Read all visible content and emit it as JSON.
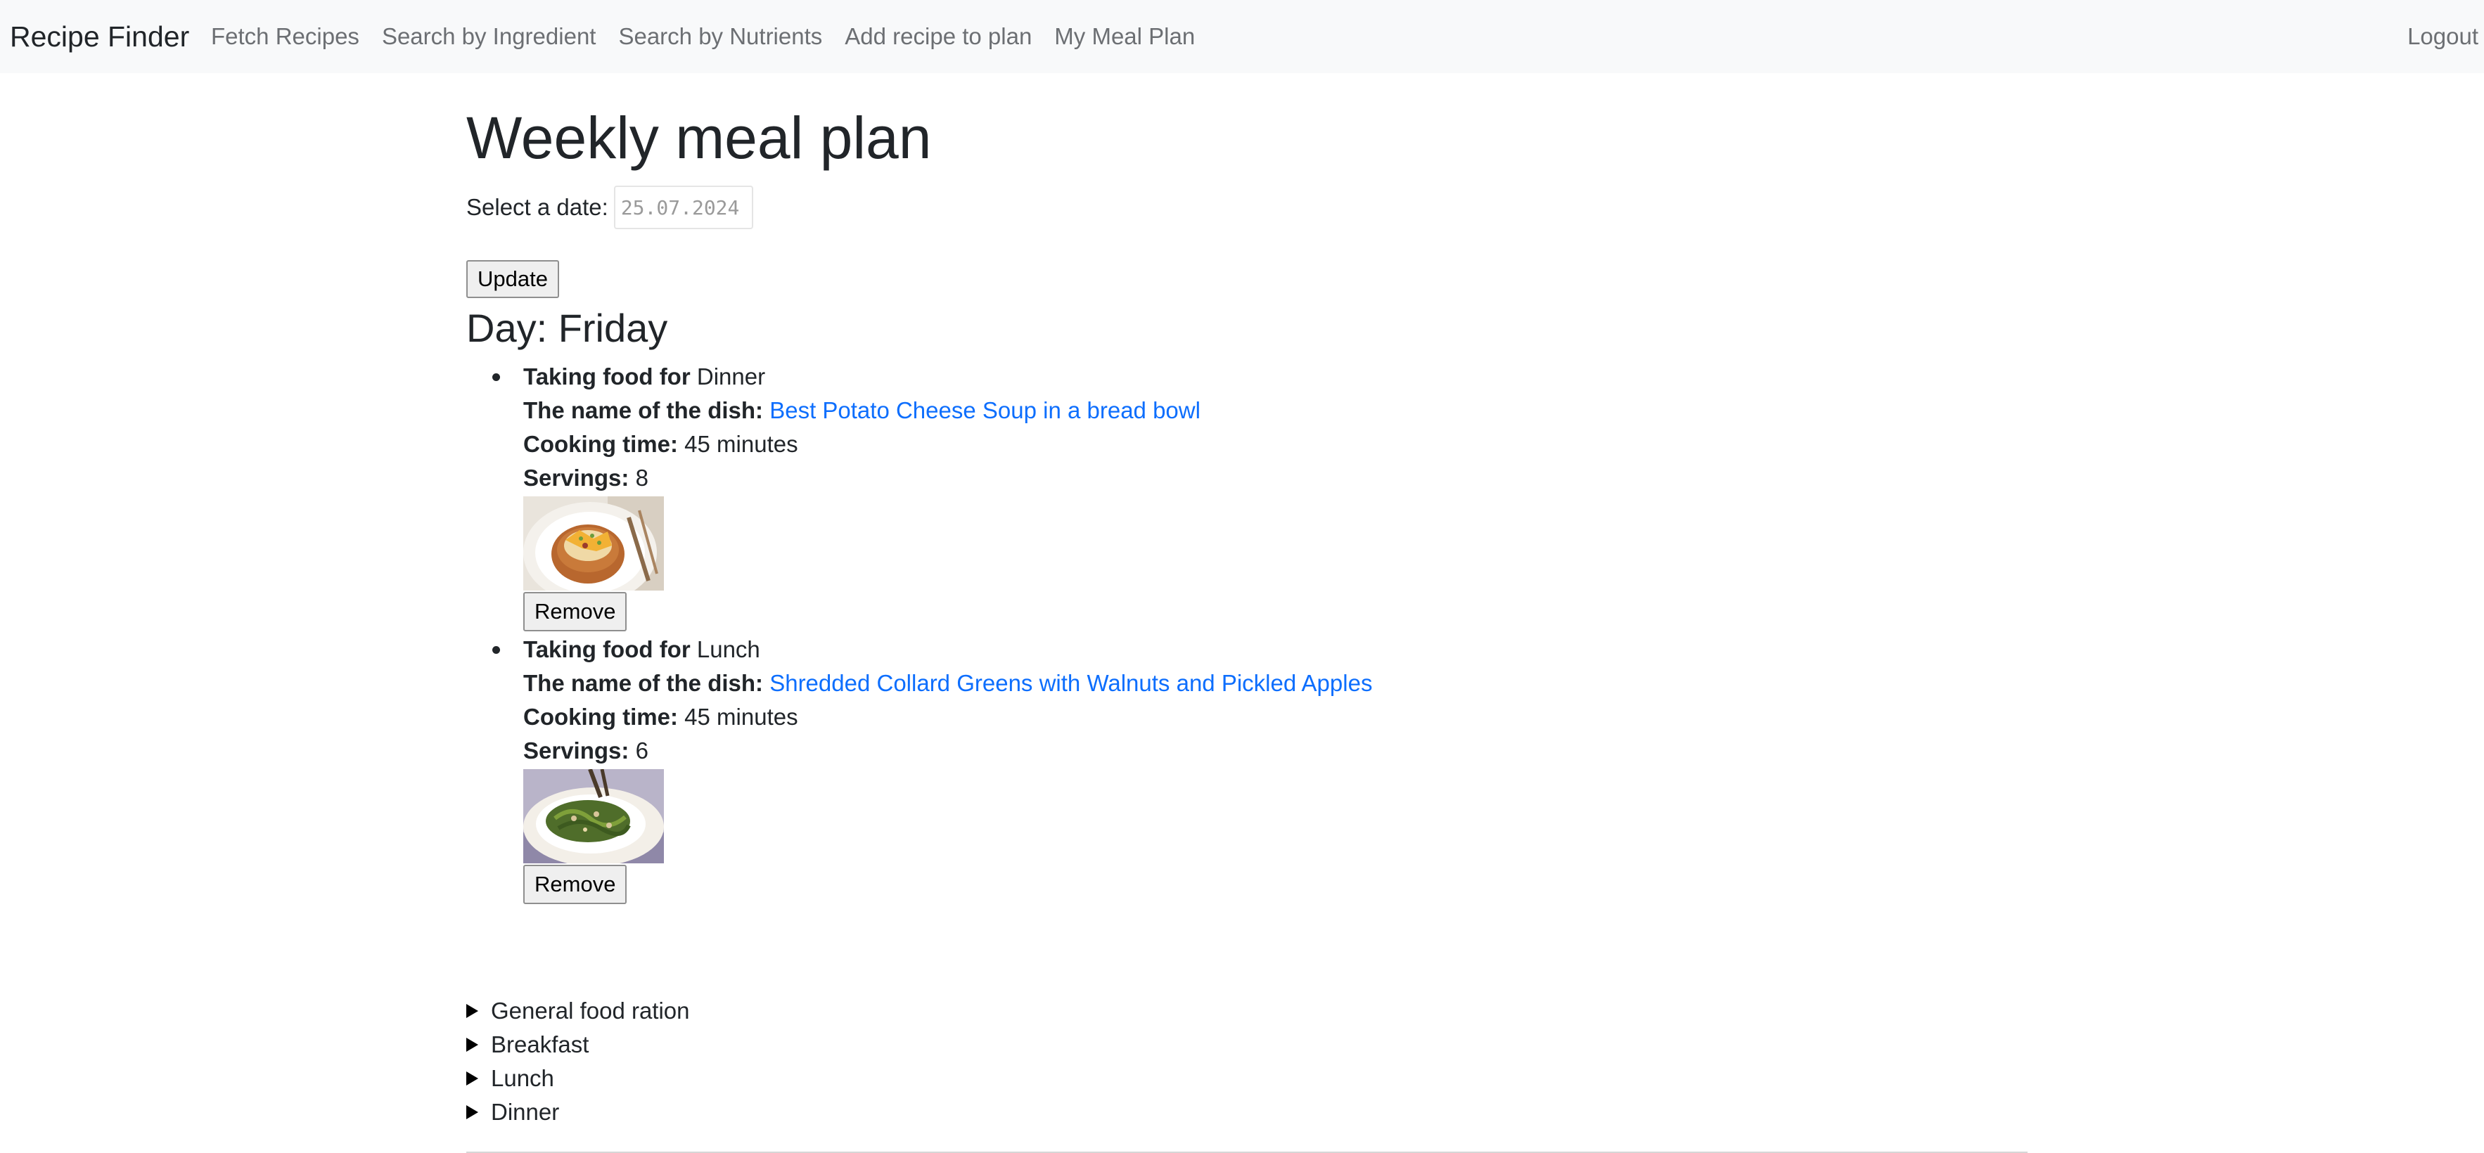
{
  "navbar": {
    "brand": "Recipe Finder",
    "links": [
      "Fetch Recipes",
      "Search by Ingredient",
      "Search by Nutrients",
      "Add recipe to plan",
      "My Meal Plan"
    ],
    "logout": "Logout"
  },
  "page": {
    "title": "Weekly meal plan",
    "date_label": "Select a date:",
    "date_value": "25.07.2024",
    "update_label": "Update",
    "day_heading": "Day: Friday"
  },
  "labels": {
    "taking_food_for": "Taking food for",
    "dish_name": "The name of the dish:",
    "cooking_time": "Cooking time:",
    "servings": "Servings:",
    "remove": "Remove"
  },
  "meals": [
    {
      "meal_type": "Dinner",
      "dish": "Best Potato Cheese Soup in a bread bowl",
      "cooking_time": "45 minutes",
      "servings": "8",
      "image_icon": "potato-soup-bread-bowl-photo"
    },
    {
      "meal_type": "Lunch",
      "dish": "Shredded Collard Greens with Walnuts and Pickled Apples",
      "cooking_time": "45 minutes",
      "servings": "6",
      "image_icon": "collard-greens-plate-photo"
    }
  ],
  "expandable_sections": [
    "General food ration",
    "Breakfast",
    "Lunch",
    "Dinner"
  ],
  "colors": {
    "navbar_bg": "#f8f9fa",
    "link": "#0d6efd",
    "nav_text": "#6c6f73",
    "text": "#212529"
  }
}
